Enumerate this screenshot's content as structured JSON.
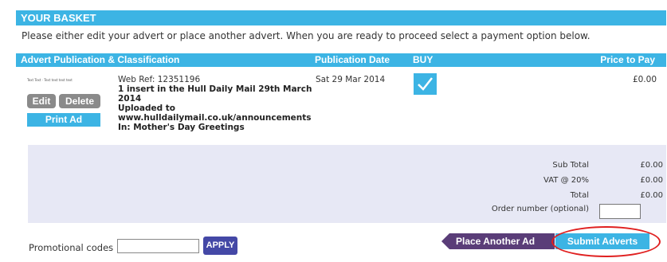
{
  "basket": {
    "title": "YOUR BASKET",
    "intro": "Please either edit your advert or place another advert. When you are ready to proceed select a payment option below."
  },
  "table": {
    "headers": {
      "classification": "Advert Publication & Classification",
      "date": "Publication Date",
      "buy": "BUY",
      "price": "Price to Pay"
    }
  },
  "item": {
    "thumb_text": "Text Text · Text text text text",
    "edit_label": "Edit",
    "delete_label": "Delete",
    "print_label": "Print Ad",
    "web_ref": "Web Ref: 12351196",
    "insert_line1": "1 insert in the Hull Daily Mail 29th March",
    "insert_line2": "2014",
    "uploaded_line1": "Uploaded to",
    "uploaded_line2": "www.hulldailymail.co.uk/announcements",
    "category": "In: Mother's Day Greetings",
    "publication_date": "Sat 29 Mar 2014",
    "buy_checked": true,
    "price": "£0.00"
  },
  "totals": {
    "sub_total_label": "Sub Total",
    "sub_total": "£0.00",
    "vat_label": "VAT @ 20%",
    "vat": "£0.00",
    "total_label": "Total",
    "total": "£0.00",
    "order_number_label": "Order number (optional)",
    "order_number_value": ""
  },
  "promo": {
    "label": "Promotional codes",
    "value": "",
    "apply_label": "APPLY"
  },
  "actions": {
    "place_another_label": "Place Another Ad",
    "submit_label": "Submit Adverts"
  },
  "colors": {
    "accent_blue": "#3cb4e4",
    "purple": "#5a3d78",
    "apply_blue": "#4448a6",
    "totals_bg": "#e7e8f5",
    "highlight_red": "#e02020"
  }
}
